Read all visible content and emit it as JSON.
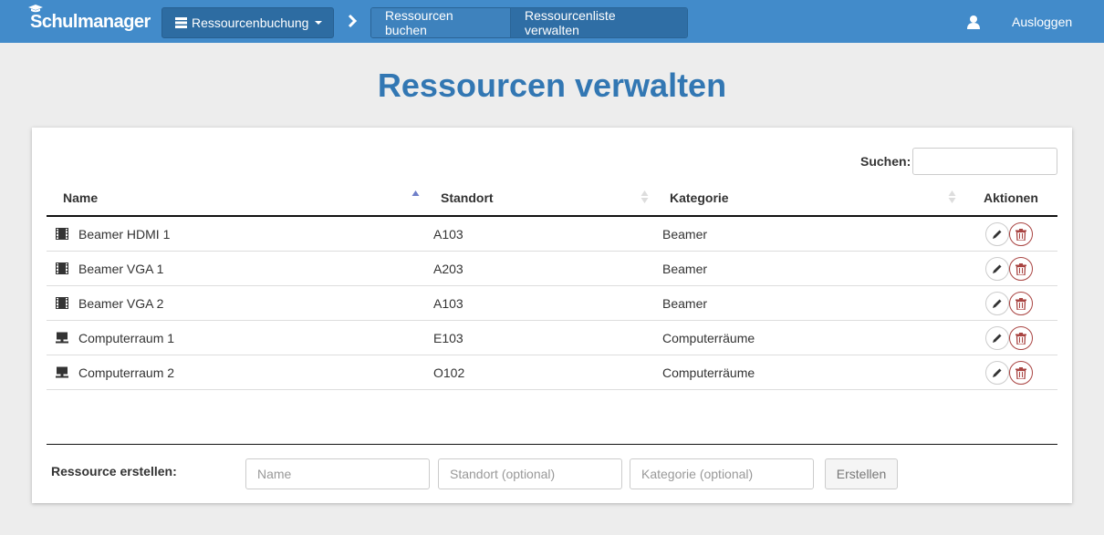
{
  "app": {
    "brand": "Schulmanager"
  },
  "header": {
    "module_button": "Ressourcenbuchung",
    "tabs": [
      {
        "label": "Ressourcen buchen"
      },
      {
        "label": "Ressourcenliste verwalten"
      }
    ],
    "logout": "Ausloggen",
    "colors": {
      "bar": "#428bca",
      "title": "#3277b3"
    }
  },
  "page": {
    "title": "Ressourcen verwalten"
  },
  "search": {
    "label": "Suchen:",
    "value": ""
  },
  "table": {
    "columns": [
      "Name",
      "Standort",
      "Kategorie",
      "Aktionen"
    ],
    "rows": [
      {
        "icon": "film-icon",
        "name": "Beamer HDMI 1",
        "standort": "A103",
        "kategorie": "Beamer"
      },
      {
        "icon": "film-icon",
        "name": "Beamer VGA 1",
        "standort": "A203",
        "kategorie": "Beamer"
      },
      {
        "icon": "film-icon",
        "name": "Beamer VGA 2",
        "standort": "A103",
        "kategorie": "Beamer"
      },
      {
        "icon": "monitor-icon",
        "name": "Computerraum 1",
        "standort": "E103",
        "kategorie": "Computerräume"
      },
      {
        "icon": "monitor-icon",
        "name": "Computerraum 2",
        "standort": "O102",
        "kategorie": "Computerräume"
      }
    ]
  },
  "create": {
    "label": "Ressource erstellen:",
    "name_placeholder": "Name",
    "standort_placeholder": "Standort (optional)",
    "kategorie_placeholder": "Kategorie (optional)",
    "button": "Erstellen"
  }
}
